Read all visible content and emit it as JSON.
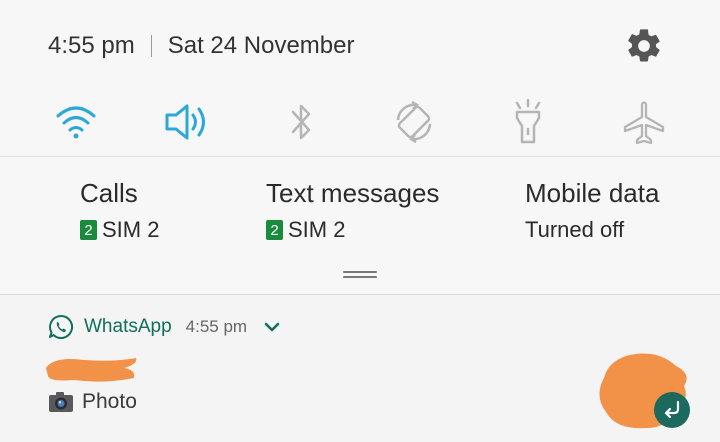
{
  "status": {
    "time": "4:55 pm",
    "date": "Sat 24 November"
  },
  "quick_toggles": [
    {
      "icon": "wifi-icon",
      "active": true
    },
    {
      "icon": "sound-icon",
      "active": true
    },
    {
      "icon": "bluetooth-icon",
      "active": false
    },
    {
      "icon": "auto-rotate-icon",
      "active": false
    },
    {
      "icon": "flashlight-icon",
      "active": false
    },
    {
      "icon": "airplane-mode-icon",
      "active": false
    }
  ],
  "sim_settings": [
    {
      "title": "Calls",
      "badge": "2",
      "value": "SIM 2"
    },
    {
      "title": "Text messages",
      "badge": "2",
      "value": "SIM 2"
    },
    {
      "title": "Mobile data",
      "badge": "",
      "value": "Turned off"
    }
  ],
  "notification": {
    "app": "WhatsApp",
    "time": "4:55 pm",
    "message": "Photo"
  },
  "colors": {
    "active_toggle": "#2aa9d8",
    "inactive_toggle": "#b5b5b5",
    "whatsapp_green": "#0e6f5a",
    "sim_badge": "#1a8a3c",
    "redaction": "#f29148"
  }
}
